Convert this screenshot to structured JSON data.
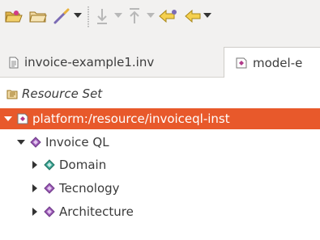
{
  "toolbar": {
    "buttons": [
      {
        "name": "open-folder-icon"
      },
      {
        "name": "folder-icon"
      },
      {
        "name": "wand-icon"
      },
      {
        "name": "download-icon"
      },
      {
        "name": "upload-icon"
      },
      {
        "name": "back-arrow-icon"
      },
      {
        "name": "forward-arrow-icon"
      }
    ]
  },
  "tabs": [
    {
      "label": "invoice-example1.inv",
      "icon": "document-icon"
    },
    {
      "label": "model-e",
      "icon": "model-icon"
    }
  ],
  "tree": {
    "resource_set_label": "Resource Set",
    "platform_label": "platform:/resource/invoiceql-inst",
    "invoice_label": "Invoice QL",
    "children": [
      "Domain",
      "Tecnology",
      "Architecture"
    ]
  },
  "colors": {
    "selection": "#e8592b",
    "node_purple": "#9b59b6",
    "node_teal": "#3aa394"
  }
}
